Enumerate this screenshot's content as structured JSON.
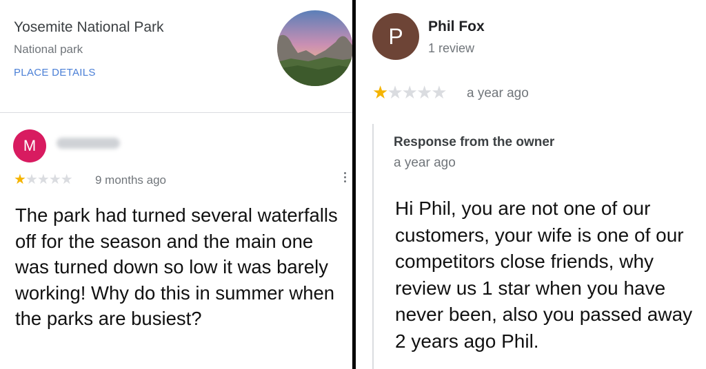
{
  "place": {
    "name": "Yosemite National Park",
    "type": "National park",
    "details_link": "PLACE DETAILS"
  },
  "left_review": {
    "avatar_letter": "M",
    "rating": 1,
    "max_rating": 5,
    "time": "9 months ago",
    "text": "The park had turned several waterfalls off for the season and the main one was turned down so low it was barely working! Why do this in summer when the parks are busiest?"
  },
  "right_review": {
    "avatar_letter": "P",
    "reviewer": "Phil Fox",
    "review_count": "1 review",
    "rating": 1,
    "max_rating": 5,
    "time": "a year ago",
    "owner_response": {
      "title": "Response from the owner",
      "time": "a year ago",
      "text": "Hi Phil, you are not one of our customers, your wife is one of our competitors close friends, why review us 1 star when you have never been, also you passed away 2 years ago Phil."
    }
  },
  "colors": {
    "star_on": "#f5b400",
    "star_off": "#dadce0",
    "avatar_m": "#d81b60",
    "avatar_p": "#6d4436",
    "link": "#4a7fd6"
  },
  "icons": [
    "star-icon",
    "more-vert-icon"
  ]
}
